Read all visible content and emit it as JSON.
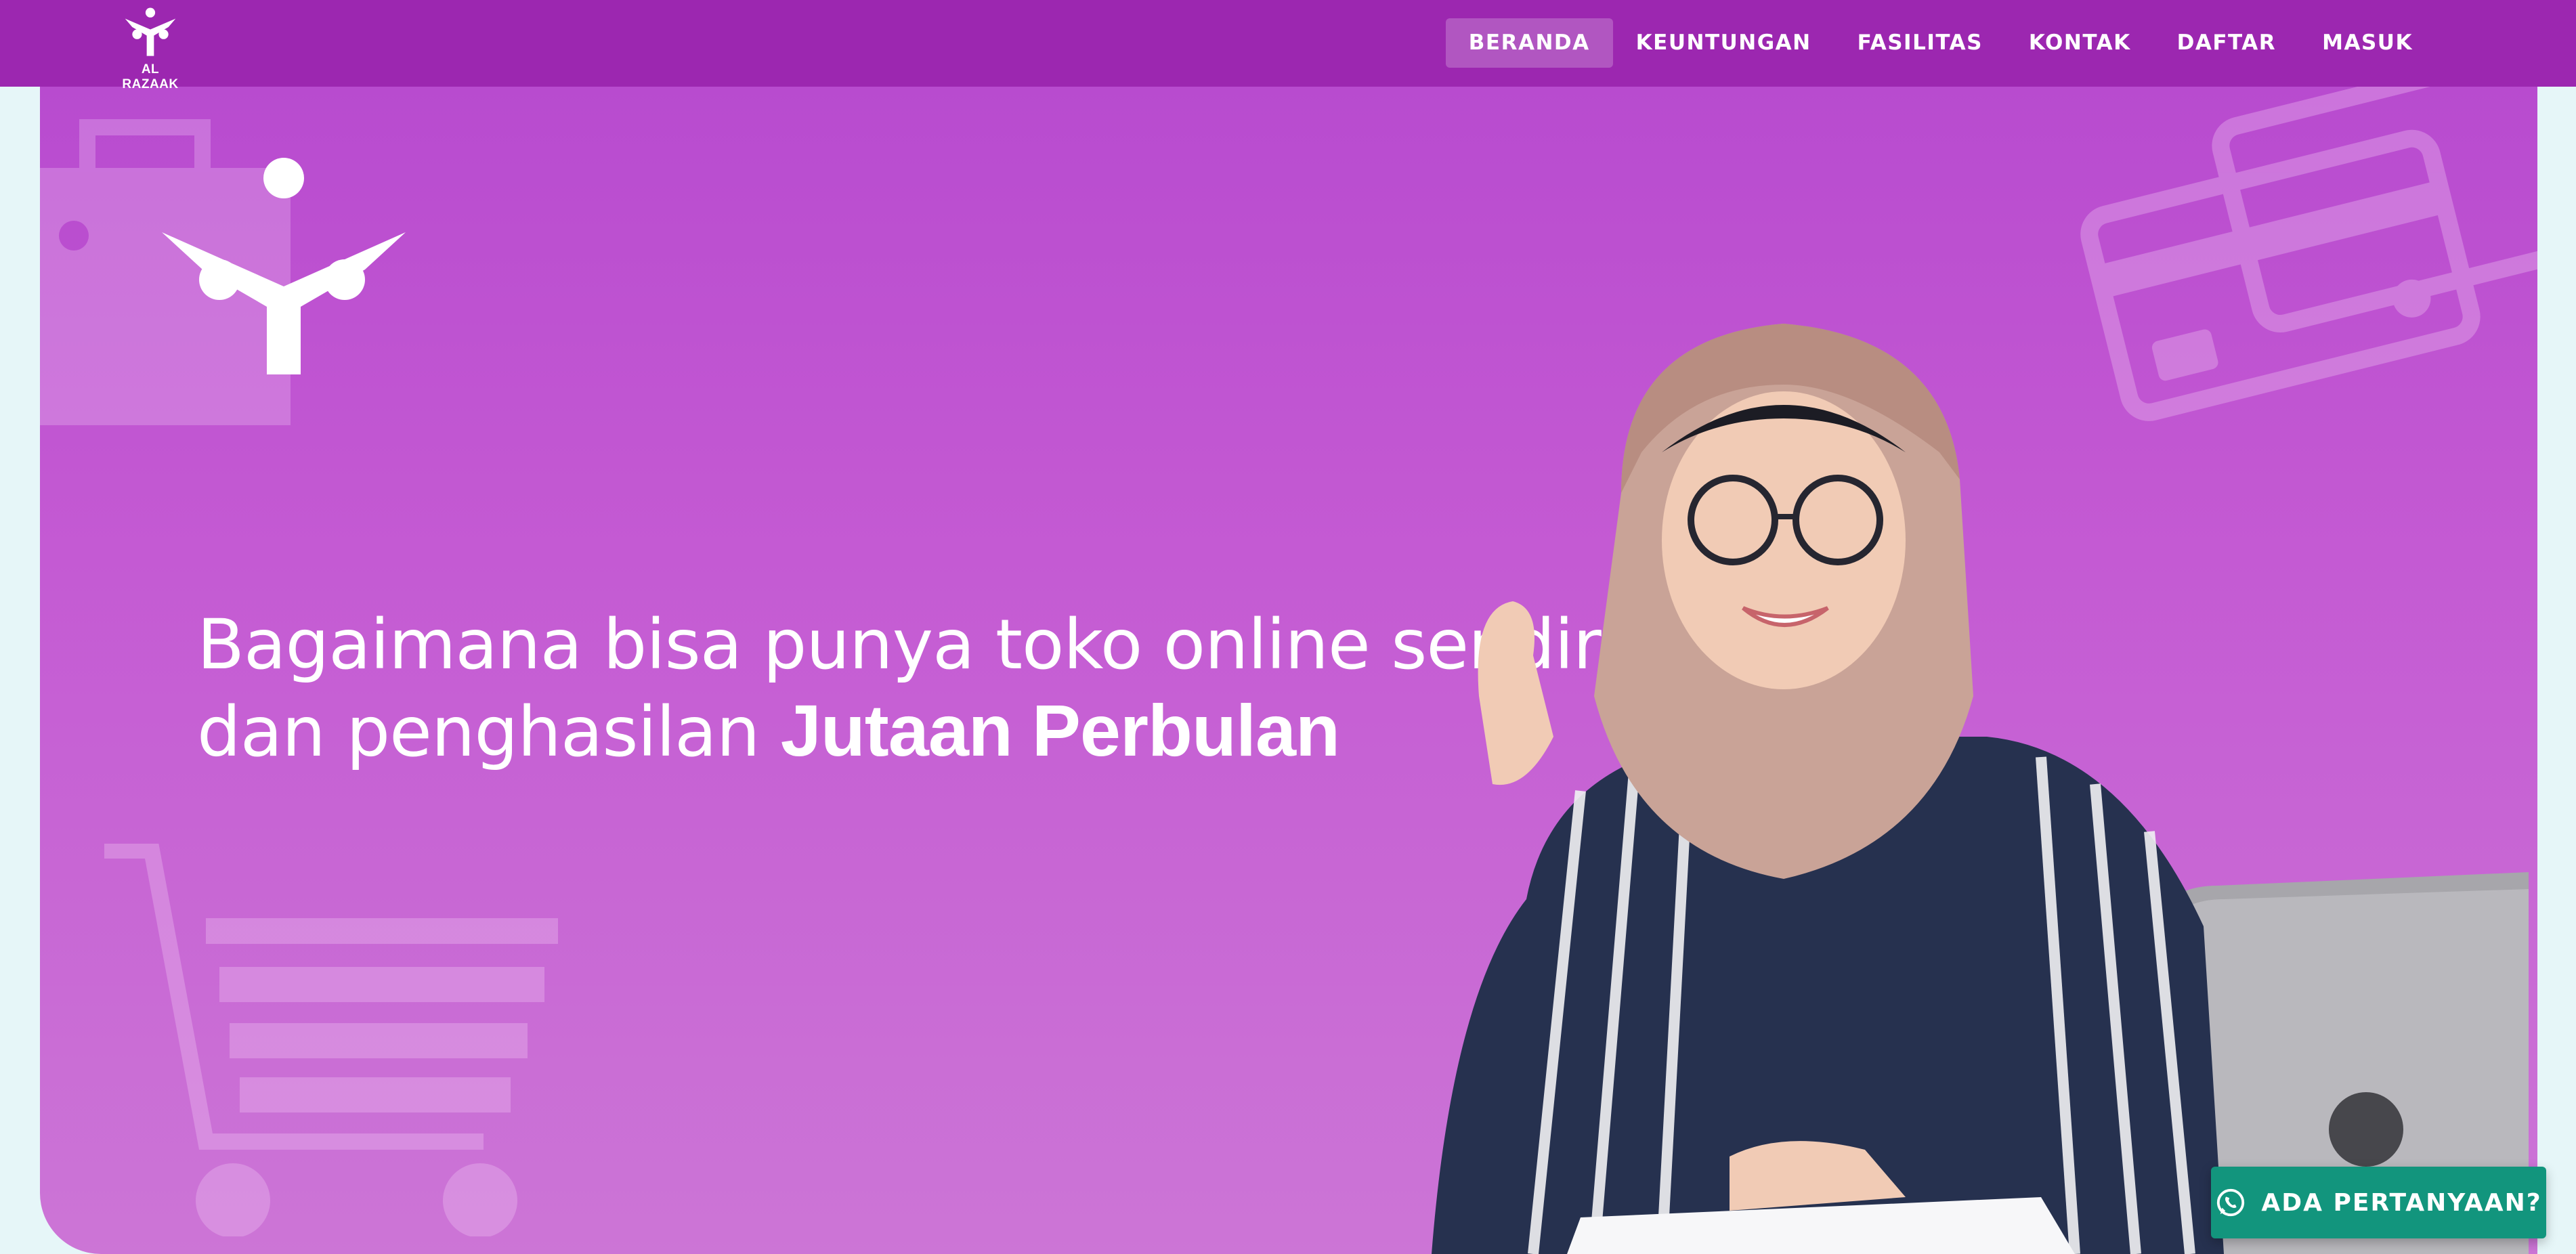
{
  "brand": {
    "name": "AL RAZAAK"
  },
  "nav": {
    "items": [
      {
        "label": "BERANDA",
        "active": true
      },
      {
        "label": "KEUNTUNGAN",
        "active": false
      },
      {
        "label": "FASILITAS",
        "active": false
      },
      {
        "label": "KONTAK",
        "active": false
      },
      {
        "label": "DAFTAR",
        "active": false
      },
      {
        "label": "MASUK",
        "active": false
      }
    ]
  },
  "hero": {
    "line1": "Bagaimana bisa punya toko online sendiri",
    "line2_prefix": "dan penghasilan ",
    "line2_bold": "Jutaan Perbulan"
  },
  "whatsapp": {
    "label": "ADA PERTANYAAN?",
    "icon": "whatsapp-icon"
  },
  "colors": {
    "header": "#9c27b0",
    "hero_top": "#b84bcf",
    "hero_bottom": "#cc75d6",
    "wa_button": "#12957d",
    "page_bg": "#e6f6f8"
  },
  "icons": [
    "brand-logo-icon",
    "shopping-bag-icon",
    "credit-card-icon",
    "shopping-cart-icon",
    "whatsapp-icon"
  ]
}
